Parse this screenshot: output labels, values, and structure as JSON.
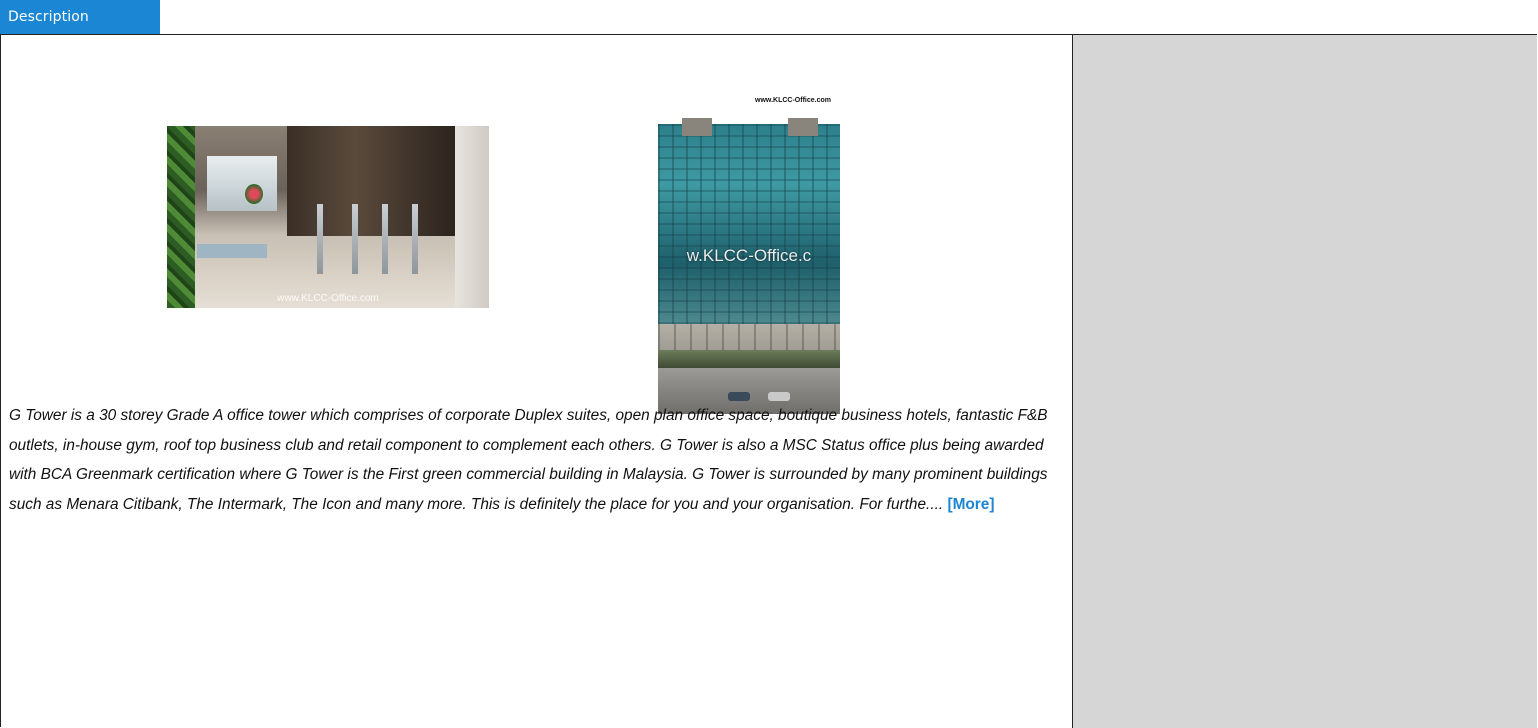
{
  "tab": {
    "label": "Description"
  },
  "images": {
    "lobby": {
      "alt": "G Tower lobby with turnstile gates",
      "watermark": "www.KLCC-Office.com"
    },
    "tower": {
      "caption": "www.KLCC-Office.com",
      "alt": "G Tower building exterior",
      "watermark": "w.KLCC-Office.c"
    }
  },
  "description": {
    "text": "G Tower is a 30 storey Grade A office tower which comprises of corporate Duplex suites, open plan office space, boutique business hotels, fantastic F&B outlets, in-house gym, roof top business club and retail component to complement each others. G Tower is also a MSC Status office plus being awarded with BCA Greenmark certification where G Tower is the First green commercial building in Malaysia.    G Tower is surrounded by many prominent buildings such as Menara Citibank, The Intermark, The Icon and many more. This is definitely the place for you and your organisation.   For furthe....",
    "more_label": "[More]"
  },
  "colors": {
    "accent": "#1a86d4",
    "sidebar_bg": "#d6d6d6",
    "border": "#222222"
  }
}
